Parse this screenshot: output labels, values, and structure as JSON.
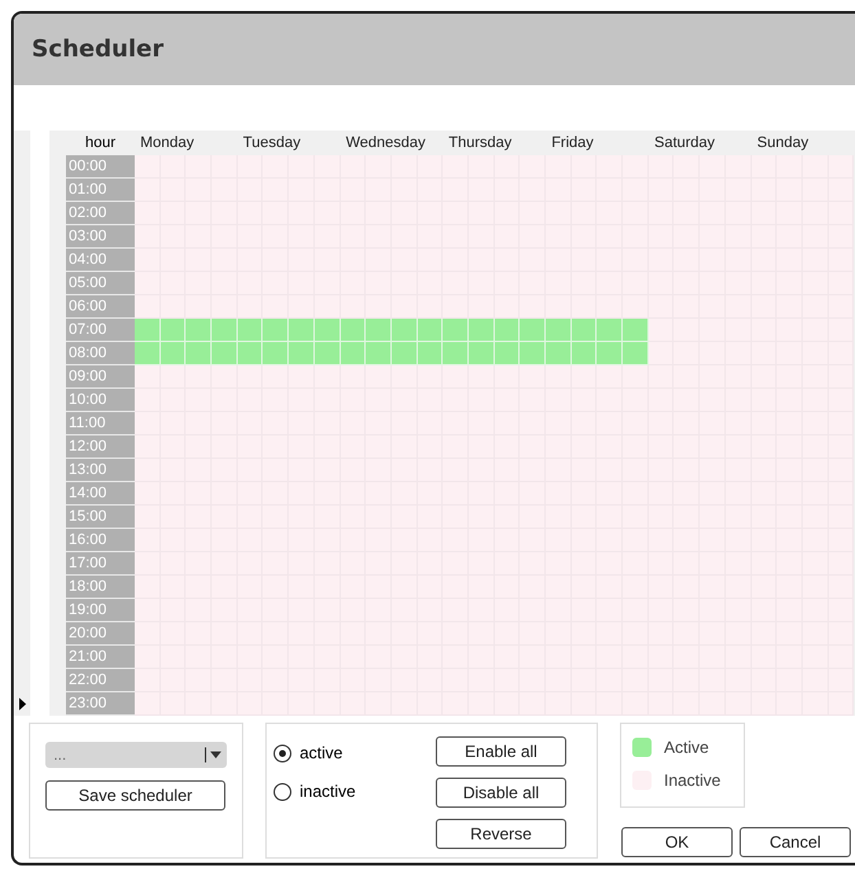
{
  "window": {
    "title": "Scheduler"
  },
  "grid": {
    "hour_header": "hour",
    "days": [
      "Monday",
      "Tuesday",
      "Wednesday",
      "Thursday",
      "Friday",
      "Saturday",
      "Sunday"
    ],
    "rows": [
      {
        "hour": "00:00",
        "current": false,
        "cells": [
          false,
          false,
          false,
          false,
          false,
          false,
          false,
          false,
          false,
          false,
          false,
          false,
          false,
          false,
          false,
          false,
          false,
          false,
          false,
          false,
          false,
          false,
          false,
          false,
          false,
          false,
          false,
          false
        ]
      },
      {
        "hour": "01:00",
        "current": false,
        "cells": [
          false,
          false,
          false,
          false,
          false,
          false,
          false,
          false,
          false,
          false,
          false,
          false,
          false,
          false,
          false,
          false,
          false,
          false,
          false,
          false,
          false,
          false,
          false,
          false,
          false,
          false,
          false,
          false
        ]
      },
      {
        "hour": "02:00",
        "current": false,
        "cells": [
          false,
          false,
          false,
          false,
          false,
          false,
          false,
          false,
          false,
          false,
          false,
          false,
          false,
          false,
          false,
          false,
          false,
          false,
          false,
          false,
          false,
          false,
          false,
          false,
          false,
          false,
          false,
          false
        ]
      },
      {
        "hour": "03:00",
        "current": false,
        "cells": [
          false,
          false,
          false,
          false,
          false,
          false,
          false,
          false,
          false,
          false,
          false,
          false,
          false,
          false,
          false,
          false,
          false,
          false,
          false,
          false,
          false,
          false,
          false,
          false,
          false,
          false,
          false,
          false
        ]
      },
      {
        "hour": "04:00",
        "current": false,
        "cells": [
          false,
          false,
          false,
          false,
          false,
          false,
          false,
          false,
          false,
          false,
          false,
          false,
          false,
          false,
          false,
          false,
          false,
          false,
          false,
          false,
          false,
          false,
          false,
          false,
          false,
          false,
          false,
          false
        ]
      },
      {
        "hour": "05:00",
        "current": false,
        "cells": [
          false,
          false,
          false,
          false,
          false,
          false,
          false,
          false,
          false,
          false,
          false,
          false,
          false,
          false,
          false,
          false,
          false,
          false,
          false,
          false,
          false,
          false,
          false,
          false,
          false,
          false,
          false,
          false
        ]
      },
      {
        "hour": "06:00",
        "current": false,
        "cells": [
          false,
          false,
          false,
          false,
          false,
          false,
          false,
          false,
          false,
          false,
          false,
          false,
          false,
          false,
          false,
          false,
          false,
          false,
          false,
          false,
          false,
          false,
          false,
          false,
          false,
          false,
          false,
          false
        ]
      },
      {
        "hour": "07:00",
        "current": false,
        "cells": [
          true,
          true,
          true,
          true,
          true,
          true,
          true,
          true,
          true,
          true,
          true,
          true,
          true,
          true,
          true,
          true,
          true,
          true,
          true,
          true,
          false,
          false,
          false,
          false,
          false,
          false,
          false,
          false
        ]
      },
      {
        "hour": "08:00",
        "current": false,
        "cells": [
          true,
          true,
          true,
          true,
          true,
          true,
          true,
          true,
          true,
          true,
          true,
          true,
          true,
          true,
          true,
          true,
          true,
          true,
          true,
          true,
          false,
          false,
          false,
          false,
          false,
          false,
          false,
          false
        ]
      },
      {
        "hour": "09:00",
        "current": false,
        "cells": [
          false,
          false,
          false,
          false,
          false,
          false,
          false,
          false,
          false,
          false,
          false,
          false,
          false,
          false,
          false,
          false,
          false,
          false,
          false,
          false,
          false,
          false,
          false,
          false,
          false,
          false,
          false,
          false
        ]
      },
      {
        "hour": "10:00",
        "current": false,
        "cells": [
          false,
          false,
          false,
          false,
          false,
          false,
          false,
          false,
          false,
          false,
          false,
          false,
          false,
          false,
          false,
          false,
          false,
          false,
          false,
          false,
          false,
          false,
          false,
          false,
          false,
          false,
          false,
          false
        ]
      },
      {
        "hour": "11:00",
        "current": false,
        "cells": [
          false,
          false,
          false,
          false,
          false,
          false,
          false,
          false,
          false,
          false,
          false,
          false,
          false,
          false,
          false,
          false,
          false,
          false,
          false,
          false,
          false,
          false,
          false,
          false,
          false,
          false,
          false,
          false
        ]
      },
      {
        "hour": "12:00",
        "current": false,
        "cells": [
          false,
          false,
          false,
          false,
          false,
          false,
          false,
          false,
          false,
          false,
          false,
          false,
          false,
          false,
          false,
          false,
          false,
          false,
          false,
          false,
          false,
          false,
          false,
          false,
          false,
          false,
          false,
          false
        ]
      },
      {
        "hour": "13:00",
        "current": false,
        "cells": [
          false,
          false,
          false,
          false,
          false,
          false,
          false,
          false,
          false,
          false,
          false,
          false,
          false,
          false,
          false,
          false,
          false,
          false,
          false,
          false,
          false,
          false,
          false,
          false,
          false,
          false,
          false,
          false
        ]
      },
      {
        "hour": "14:00",
        "current": false,
        "cells": [
          false,
          false,
          false,
          false,
          false,
          false,
          false,
          false,
          false,
          false,
          false,
          false,
          false,
          false,
          false,
          false,
          false,
          false,
          false,
          false,
          false,
          false,
          false,
          false,
          false,
          false,
          false,
          false
        ]
      },
      {
        "hour": "15:00",
        "current": false,
        "cells": [
          false,
          false,
          false,
          false,
          false,
          false,
          false,
          false,
          false,
          false,
          false,
          false,
          false,
          false,
          false,
          false,
          false,
          false,
          false,
          false,
          false,
          false,
          false,
          false,
          false,
          false,
          false,
          false
        ]
      },
      {
        "hour": "16:00",
        "current": false,
        "cells": [
          false,
          false,
          false,
          false,
          false,
          false,
          false,
          false,
          false,
          false,
          false,
          false,
          false,
          false,
          false,
          false,
          false,
          false,
          false,
          false,
          false,
          false,
          false,
          false,
          false,
          false,
          false,
          false
        ]
      },
      {
        "hour": "17:00",
        "current": false,
        "cells": [
          false,
          false,
          false,
          false,
          false,
          false,
          false,
          false,
          false,
          false,
          false,
          false,
          false,
          false,
          false,
          false,
          false,
          false,
          false,
          false,
          false,
          false,
          false,
          false,
          false,
          false,
          false,
          false
        ]
      },
      {
        "hour": "18:00",
        "current": false,
        "cells": [
          false,
          false,
          false,
          false,
          false,
          false,
          false,
          false,
          false,
          false,
          false,
          false,
          false,
          false,
          false,
          false,
          false,
          false,
          false,
          false,
          false,
          false,
          false,
          false,
          false,
          false,
          false,
          false
        ]
      },
      {
        "hour": "19:00",
        "current": false,
        "cells": [
          false,
          false,
          false,
          false,
          false,
          false,
          false,
          false,
          false,
          false,
          false,
          false,
          false,
          false,
          false,
          false,
          false,
          false,
          false,
          false,
          false,
          false,
          false,
          false,
          false,
          false,
          false,
          false
        ]
      },
      {
        "hour": "20:00",
        "current": false,
        "cells": [
          false,
          false,
          false,
          false,
          false,
          false,
          false,
          false,
          false,
          false,
          false,
          false,
          false,
          false,
          false,
          false,
          false,
          false,
          false,
          false,
          false,
          false,
          false,
          false,
          false,
          false,
          false,
          false
        ]
      },
      {
        "hour": "21:00",
        "current": false,
        "cells": [
          false,
          false,
          false,
          false,
          false,
          false,
          false,
          false,
          false,
          false,
          false,
          false,
          false,
          false,
          false,
          false,
          false,
          false,
          false,
          false,
          false,
          false,
          false,
          false,
          false,
          false,
          false,
          false
        ]
      },
      {
        "hour": "22:00",
        "current": false,
        "cells": [
          false,
          false,
          false,
          false,
          false,
          false,
          false,
          false,
          false,
          false,
          false,
          false,
          false,
          false,
          false,
          false,
          false,
          false,
          false,
          false,
          false,
          false,
          false,
          false,
          false,
          false,
          false,
          false
        ]
      },
      {
        "hour": "23:00",
        "current": true,
        "cells": [
          false,
          false,
          false,
          false,
          false,
          false,
          false,
          false,
          false,
          false,
          false,
          false,
          false,
          false,
          false,
          false,
          false,
          false,
          false,
          false,
          false,
          false,
          false,
          false,
          false,
          false,
          false,
          false
        ]
      }
    ]
  },
  "scheduler_select": {
    "value": "..."
  },
  "save_button": "Save scheduler",
  "modes": [
    {
      "label": "active",
      "selected": true
    },
    {
      "label": "inactive",
      "selected": false
    }
  ],
  "actions": [
    "Enable all",
    "Disable all",
    "Reverse"
  ],
  "legend": [
    {
      "label": "Active",
      "color": "#98ee98"
    },
    {
      "label": "Inactive",
      "color": "#fdf0f3"
    }
  ],
  "buttons": [
    "OK",
    "Cancel"
  ]
}
